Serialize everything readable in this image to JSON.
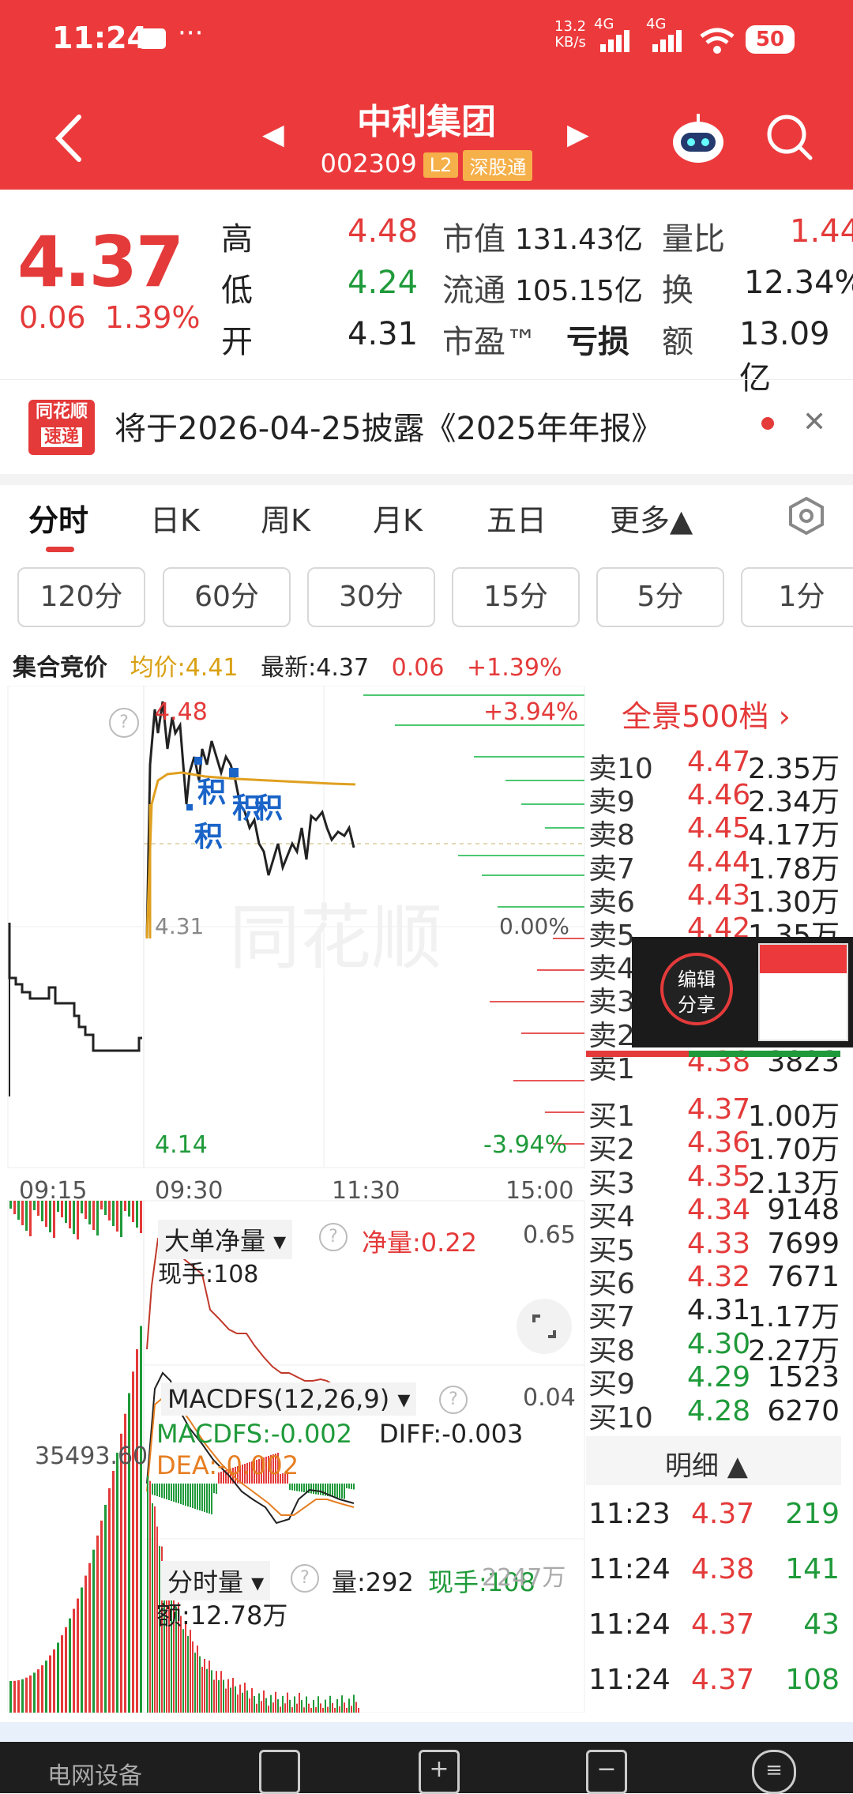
{
  "status": {
    "time": "11:24",
    "dots": "···",
    "net_speed_top": "13.2",
    "net_speed_unit": "KB/s",
    "sig1": "4G",
    "sig2": "4G",
    "battery": "50"
  },
  "header": {
    "title": "中利集团",
    "code": "002309",
    "badge_l2": "L2",
    "badge_sz": "深股通"
  },
  "quote": {
    "price": "4.37",
    "change": "0.06",
    "change_pct": "1.39%",
    "high_label": "高",
    "high": "4.48",
    "low_label": "低",
    "low": "4.24",
    "open_label": "开",
    "open": "4.31",
    "mktcap_label": "市值",
    "mktcap": "131.43亿",
    "float_label": "流通",
    "float": "105.15亿",
    "pe_label": "市盈™",
    "pe": "亏损",
    "volratio_label": "量比",
    "volratio": "1.44",
    "turnover_label": "换",
    "turnover": "12.34%",
    "amount_label": "额",
    "amount": "13.09亿"
  },
  "news": {
    "logo_top": "同花顺",
    "logo_bottom": "速递",
    "text": "将于2026-04-25披露《2025年年报》"
  },
  "tabs": [
    "分时",
    "日K",
    "周K",
    "月K",
    "五日",
    "更多▲"
  ],
  "periods": [
    "120分",
    "60分",
    "30分",
    "15分",
    "5分",
    "1分"
  ],
  "infobar": {
    "left": "集合竞价",
    "avg": "均价:4.41",
    "latest": "最新:4.37",
    "chg": "0.06",
    "pct": "+1.39%"
  },
  "chart_labels": {
    "high_price": "4.48",
    "high_pct": "+3.94%",
    "mid_price": "4.31",
    "mid_pct": "0.00%",
    "low_price": "4.14",
    "low_pct": "-3.94%",
    "t1": "09:15",
    "t2": "09:30",
    "t3": "11:30",
    "t4": "15:00",
    "ann1": "积",
    "ann2": "积",
    "ann3": "积",
    "ann4": "积",
    "big_order_label": "大单净量 ▾",
    "net_vol": "净量:0.22",
    "net_vol_max": "0.65",
    "hand": "现手:108",
    "macd_label": "MACDFS(12,26,9) ▾",
    "macd_max": "0.04",
    "macd_val": "MACDFS:-0.002",
    "diff_val": "DIFF:-0.003",
    "dea_val": "DEA:-0.002",
    "vol_left": "35493.60",
    "vol_label": "分时量 ▾",
    "vol_now": "量:292",
    "vol_hand": "现手:108",
    "vol_max": "2247万",
    "amount_now": "额:12.78万"
  },
  "orderbook": {
    "header": "全景500档 ›",
    "asks": [
      {
        "label": "卖10",
        "price": "4.47",
        "vol": "2.35万"
      },
      {
        "label": "卖9",
        "price": "4.46",
        "vol": "2.34万"
      },
      {
        "label": "卖8",
        "price": "4.45",
        "vol": "4.17万"
      },
      {
        "label": "卖7",
        "price": "4.44",
        "vol": "1.78万"
      },
      {
        "label": "卖6",
        "price": "4.43",
        "vol": "1.30万"
      },
      {
        "label": "卖5",
        "price": "4.42",
        "vol": "1.35万"
      },
      {
        "label": "卖4",
        "price": "",
        "vol": ""
      },
      {
        "label": "卖3",
        "price": "",
        "vol": ""
      },
      {
        "label": "卖2",
        "price": "",
        "vol": ""
      },
      {
        "label": "卖1",
        "price": "4.38",
        "vol": "3823"
      }
    ],
    "bids": [
      {
        "label": "买1",
        "price": "4.37",
        "vol": "1.00万"
      },
      {
        "label": "买2",
        "price": "4.36",
        "vol": "1.70万"
      },
      {
        "label": "买3",
        "price": "4.35",
        "vol": "2.13万"
      },
      {
        "label": "买4",
        "price": "4.34",
        "vol": "9148"
      },
      {
        "label": "买5",
        "price": "4.33",
        "vol": "7699"
      },
      {
        "label": "买6",
        "price": "4.32",
        "vol": "7671"
      },
      {
        "label": "买7",
        "price": "4.31",
        "vol": "1.17万"
      },
      {
        "label": "买8",
        "price": "4.30",
        "vol": "2.27万"
      },
      {
        "label": "买9",
        "price": "4.29",
        "vol": "1523"
      },
      {
        "label": "买10",
        "price": "4.28",
        "vol": "6270"
      }
    ],
    "detail_header": "明细 ▲",
    "details": [
      {
        "time": "11:23",
        "price": "4.37",
        "vol": "219"
      },
      {
        "time": "11:24",
        "price": "4.38",
        "vol": "141"
      },
      {
        "time": "11:24",
        "price": "4.37",
        "vol": "43"
      },
      {
        "time": "11:24",
        "price": "4.37",
        "vol": "108"
      }
    ]
  },
  "floater": {
    "line1": "编辑",
    "line2": "分享"
  },
  "bottom": {
    "label": "电网设备"
  },
  "colors": {
    "header_red": "#ec3a3c",
    "up": "#e43a3a",
    "down": "#1f9a3a",
    "avg_line": "#e0a020"
  }
}
